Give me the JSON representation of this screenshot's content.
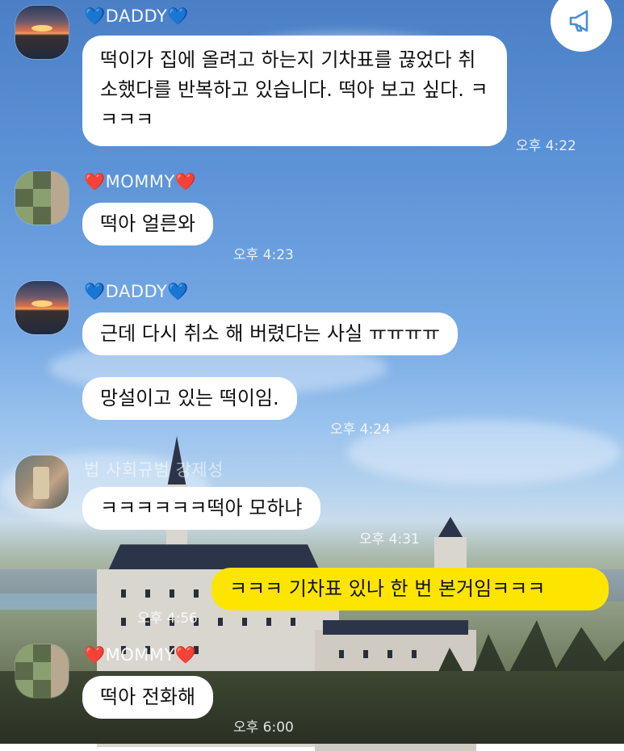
{
  "theme": {
    "bubble_mine": "#fee500",
    "bubble_other": "#ffffff",
    "heart_blue": "#2a7ee8",
    "heart_red": "#e0232e"
  },
  "header": {
    "announce_icon": "megaphone-icon"
  },
  "messages": [
    {
      "sender": {
        "prefix": "💙",
        "name": "DADDY",
        "suffix": "💙"
      },
      "bubbles": [
        {
          "text": "떡이가 집에 올려고 하는지 기차표를 끊었다 취소했다를 반복하고 있습니다. 떡아 보고 싶다. ㅋㅋㅋㅋ"
        }
      ],
      "time": "오후 4:22"
    },
    {
      "sender": {
        "prefix": "❤️",
        "name": "MOMMY",
        "suffix": "❤️"
      },
      "bubbles": [
        {
          "text": "떡아 얼른와"
        }
      ],
      "time": "오후 4:23"
    },
    {
      "sender": {
        "prefix": "💙",
        "name": "DADDY",
        "suffix": "💙"
      },
      "bubbles": [
        {
          "text": "근데 다시 취소 해 버렸다는 사실 ㅠㅠㅠㅠ"
        },
        {
          "text": "망설이고 있는 떡이임."
        }
      ],
      "time": "오후 4:24"
    },
    {
      "sender": {
        "name": "법 사회규범 강제성"
      },
      "bubbles": [
        {
          "text": "ㅋㅋㅋㅋㅋㅋ떡아 모하냐"
        }
      ],
      "time": "오후 4:31"
    },
    {
      "mine": true,
      "bubbles": [
        {
          "text": "ㅋㅋㅋ 기차표 있나 한 번 본거임ㅋㅋㅋ"
        }
      ],
      "time": "오후 4:56"
    },
    {
      "sender": {
        "prefix": "❤️",
        "name": "MOMMY",
        "suffix": "❤️"
      },
      "bubbles": [
        {
          "text": "떡아 전화해"
        }
      ],
      "time": "오후 6:00"
    }
  ]
}
